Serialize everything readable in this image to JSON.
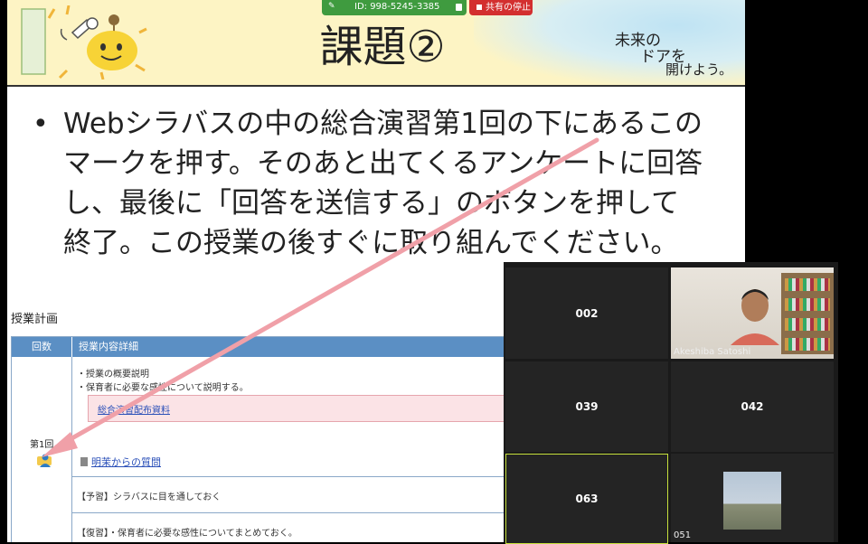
{
  "share_toolbar": {
    "meeting_id": "ID: 998-5245-3385",
    "stop_label": "共有の停止"
  },
  "slide": {
    "title": "課題②",
    "tagline": [
      "未来の",
      "ドアを",
      "開けよう。"
    ],
    "bullet": "Webシラバスの中の総合演習第1回の下にあるこのマークを押す。そのあと出てくるアンケートに回答し、最後に「回答を送信する」のボタンを押して終了。この授業の後すぐに取り組んでください。",
    "colors": {
      "header_bg": "#fdf4c4",
      "arrow": "#f0a0a8"
    }
  },
  "syllabus": {
    "heading": "授業計画",
    "headers": [
      "回数",
      "授業内容詳細"
    ],
    "lines": [
      "・授業の概要説明",
      "・保育者に必要な感性について説明する。"
    ],
    "material_link": "総合演習配布資料",
    "round": "第1回",
    "question_link": "明茉からの質問",
    "prep": "【予習】シラバスに目を通しておく",
    "review": "【復習】・保育者に必要な感性についてまとめておく。"
  },
  "gallery": {
    "tiles": [
      {
        "label": "002"
      },
      {
        "label": "Akeshiba Satoshi"
      },
      {
        "label": "039"
      },
      {
        "label": "042"
      },
      {
        "label": "063"
      },
      {
        "label": "051"
      }
    ],
    "active_border_color": "#c6e03c"
  }
}
